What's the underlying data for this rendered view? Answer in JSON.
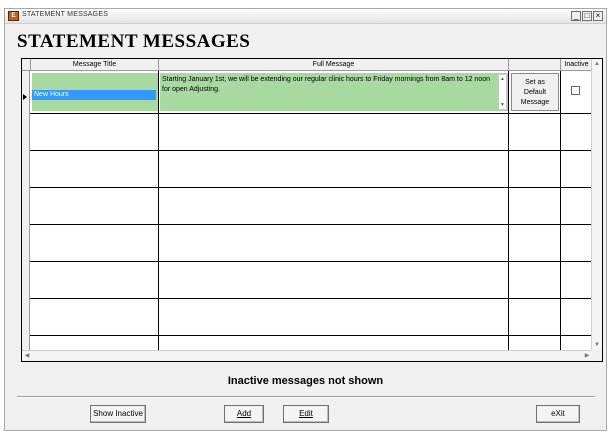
{
  "window": {
    "title": "STATEMENT MESSAGES",
    "controls": {
      "minimize": "_",
      "maximize": "□",
      "close": "×"
    }
  },
  "heading": "STATEMENT MESSAGES",
  "grid": {
    "columns": {
      "message_title": "Message Title",
      "full_message": "Full Message",
      "inactive": "Inactive"
    },
    "rows": [
      {
        "title": "New Hours",
        "message": "Starting January 1st, we will be extending our regular clinic hours to Friday mornings from 8am to 12 noon for open Adjusting.",
        "default_button": [
          "Set as",
          "Default",
          "Message"
        ],
        "inactive": false
      }
    ]
  },
  "status_text": "Inactive messages not shown",
  "buttons": {
    "show_inactive": "Show Inactive",
    "add": "Add",
    "edit": "Edit",
    "exit": "eXit"
  },
  "colors": {
    "selected_row": "#a7d9a0",
    "selected_title": "#3399ff"
  }
}
